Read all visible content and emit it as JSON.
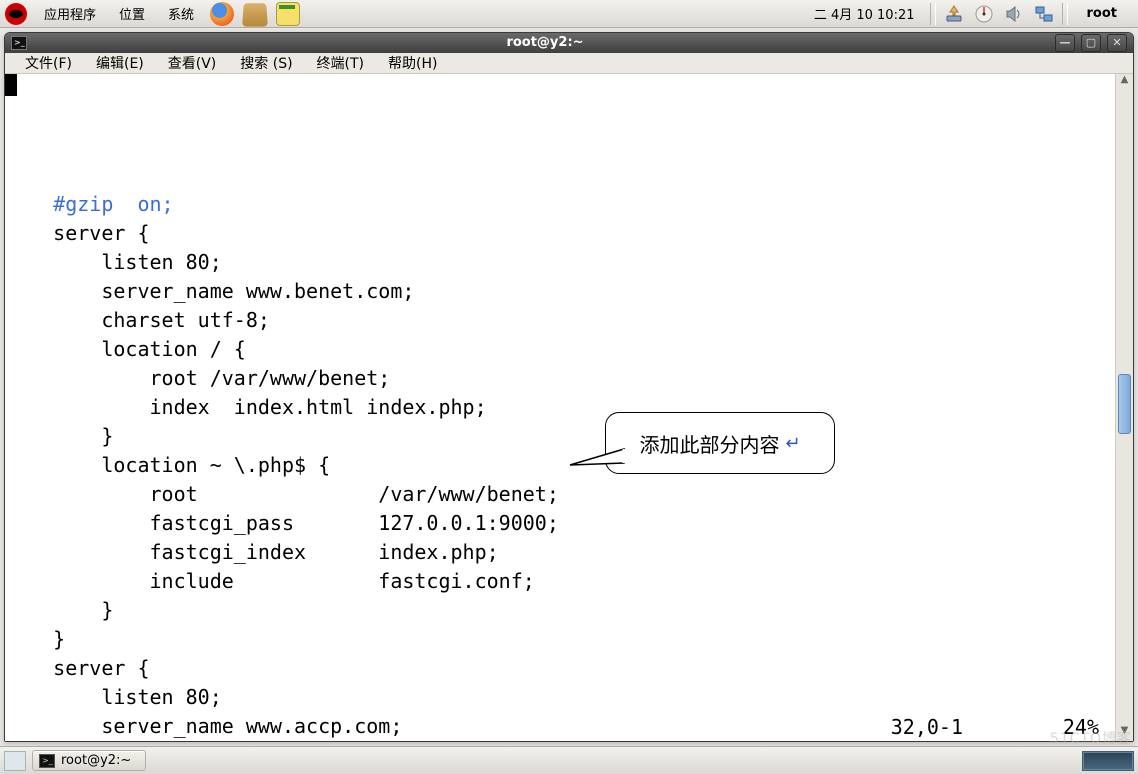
{
  "panel": {
    "menus": {
      "apps": "应用程序",
      "places": "位置",
      "system": "系统"
    },
    "clock": "二  4月 10 10:21",
    "username": "root"
  },
  "window": {
    "title": "root@y2:~",
    "menubar": {
      "file": "文件(F)",
      "edit": "编辑(E)",
      "view": "查看(V)",
      "search": "搜索 (S)",
      "terminal": "终端(T)",
      "help": "帮助(H)"
    },
    "status": {
      "pos": "32,0-1",
      "pct": "24%"
    }
  },
  "terminal": {
    "lines": [
      {
        "text": "",
        "cls": ""
      },
      {
        "text": "    #gzip  on;",
        "cls": "comment"
      },
      {
        "text": "    server {",
        "cls": ""
      },
      {
        "text": "        listen 80;",
        "cls": ""
      },
      {
        "text": "        server_name www.benet.com;",
        "cls": ""
      },
      {
        "text": "        charset utf-8;",
        "cls": ""
      },
      {
        "text": "        location / {",
        "cls": ""
      },
      {
        "text": "            root /var/www/benet;",
        "cls": ""
      },
      {
        "text": "            index  index.html index.php;",
        "cls": ""
      },
      {
        "text": "        }",
        "cls": ""
      },
      {
        "text": "        location ~ \\.php$ {",
        "cls": ""
      },
      {
        "text": "            root               /var/www/benet;",
        "cls": ""
      },
      {
        "text": "            fastcgi_pass       127.0.0.1:9000;",
        "cls": ""
      },
      {
        "text": "            fastcgi_index      index.php;",
        "cls": ""
      },
      {
        "text": "            include            fastcgi.conf;",
        "cls": ""
      },
      {
        "text": "        }",
        "cls": ""
      },
      {
        "text": "    }",
        "cls": ""
      },
      {
        "text": "    server {",
        "cls": ""
      },
      {
        "text": "        listen 80;",
        "cls": ""
      },
      {
        "text": "        server_name www.accp.com;",
        "cls": ""
      }
    ]
  },
  "callout": {
    "text": "添加此部分内容"
  },
  "taskbar": {
    "task_label": "root@y2:~"
  },
  "watermark": "51CTO博客"
}
